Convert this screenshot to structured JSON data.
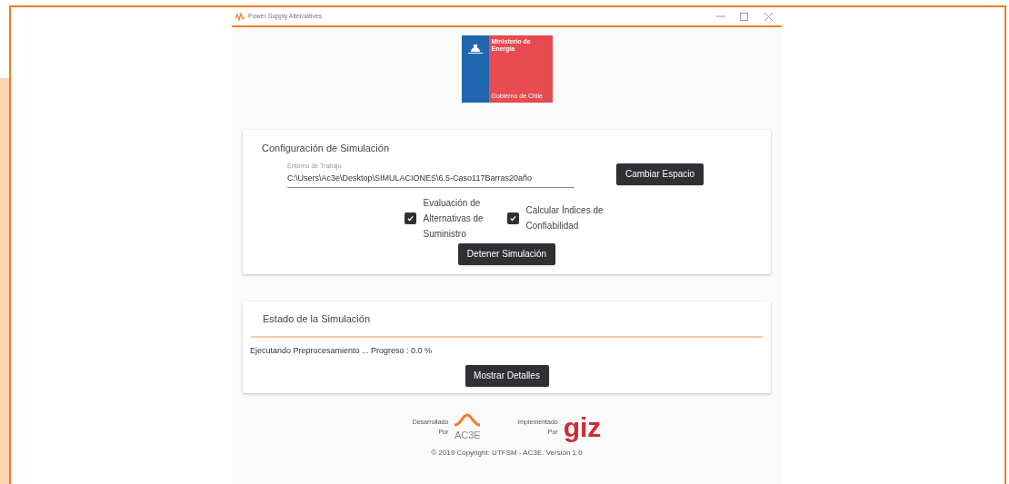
{
  "window": {
    "title": "Power Supply Alternatives"
  },
  "logo": {
    "ministry": "Ministerio de Energía",
    "government": "Gobierno de Chile"
  },
  "config": {
    "title": "Configuración de Simulación",
    "field": {
      "label": "Entorno de Trabajo",
      "value": "C:\\Users\\Ac3e\\Desktop\\SIMULACIONES\\6.5-Caso117Barras20año"
    },
    "change_button": "Cambiar Espacio",
    "options": [
      {
        "label": "Evaluación de Alternativas de Suministro",
        "checked": true
      },
      {
        "label": "Calcular Índices de Confiabilidad",
        "checked": true
      }
    ],
    "stop_button": "Detener Simulación"
  },
  "status": {
    "title": "Estado de la Simulación",
    "message": "Ejecutando Preprocesamiento ... Progreso : 0.0 %",
    "details_button": "Mostrar Detalles"
  },
  "footer": {
    "developed_by": [
      "Desarrollado",
      "Por"
    ],
    "developer_logo": "AC3E",
    "implemented_by": [
      "Implementado",
      "Por"
    ],
    "implementer_logo": "giz",
    "copyright": "© 2019 Copyright: UTFSM - AC3E. Versión 1.0"
  }
}
